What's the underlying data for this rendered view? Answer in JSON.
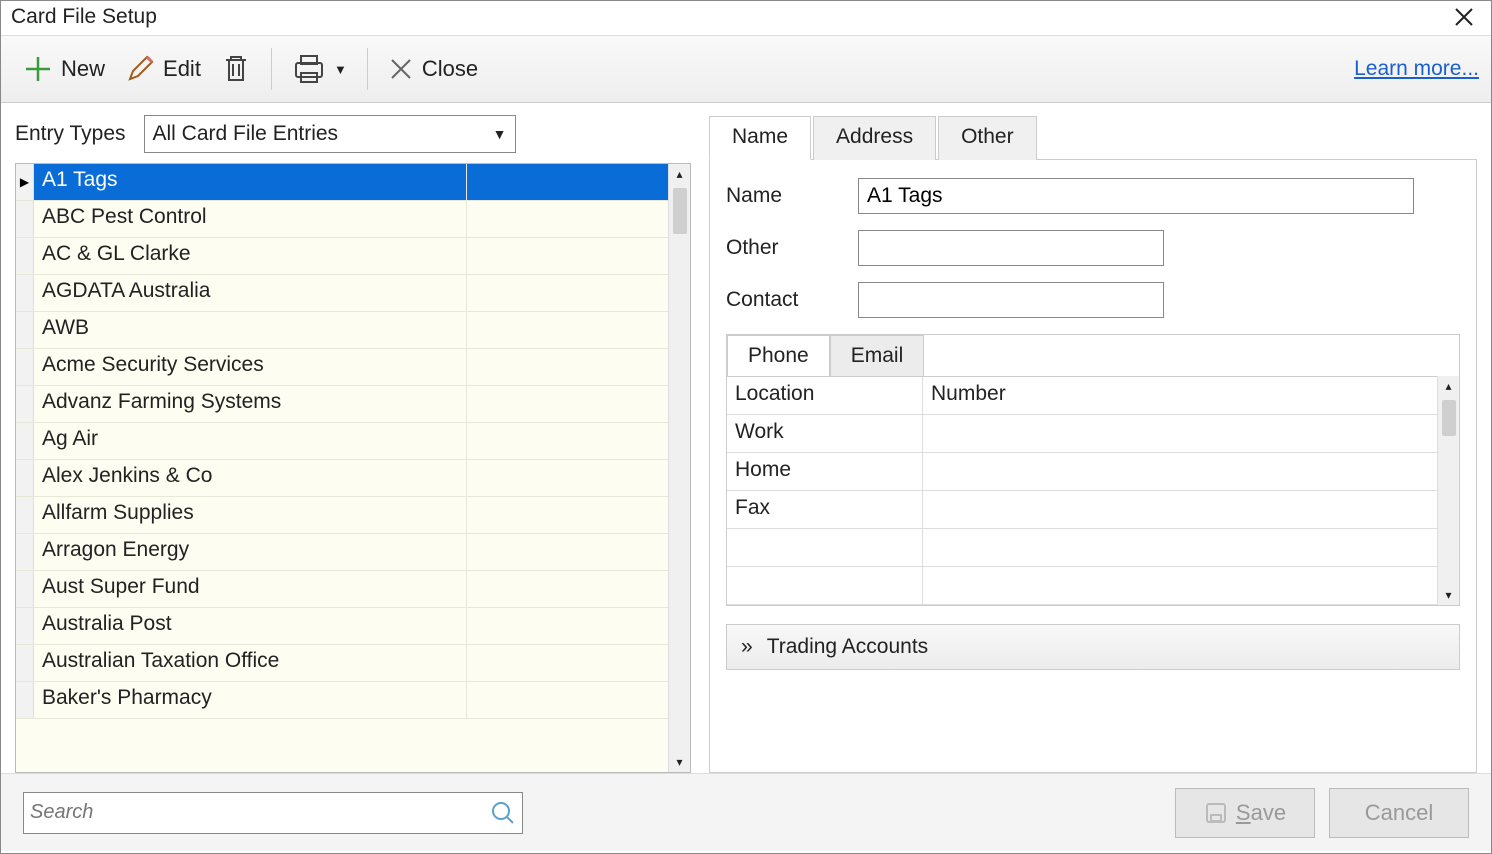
{
  "window": {
    "title": "Card File Setup"
  },
  "toolbar": {
    "new_label": "New",
    "edit_label": "Edit",
    "close_label": "Close",
    "learn_more": "Learn more..."
  },
  "entry_types": {
    "label": "Entry Types",
    "selected": "All Card File Entries"
  },
  "entries": [
    "A1 Tags",
    "ABC Pest Control",
    "AC & GL Clarke",
    "AGDATA Australia",
    "AWB",
    "Acme Security Services",
    "Advanz Farming Systems",
    "Ag Air",
    "Alex Jenkins & Co",
    "Allfarm Supplies",
    "Arragon Energy",
    "Aust Super Fund",
    "Australia Post",
    "Australian Taxation Office",
    "Baker's Pharmacy"
  ],
  "selected_index": 0,
  "tabs": {
    "name": "Name",
    "address": "Address",
    "other": "Other"
  },
  "detail": {
    "name_label": "Name",
    "name_value": "A1 Tags",
    "other_label": "Other",
    "other_value": "",
    "contact_label": "Contact",
    "contact_value": ""
  },
  "subtabs": {
    "phone": "Phone",
    "email": "Email"
  },
  "phone_grid": {
    "headers": {
      "location": "Location",
      "number": "Number"
    },
    "rows": [
      {
        "location": "Work",
        "number": ""
      },
      {
        "location": "Home",
        "number": ""
      },
      {
        "location": "Fax",
        "number": ""
      }
    ]
  },
  "trading_accounts": "Trading Accounts",
  "footer": {
    "search_placeholder": "Search",
    "save": "Save",
    "cancel": "Cancel"
  }
}
